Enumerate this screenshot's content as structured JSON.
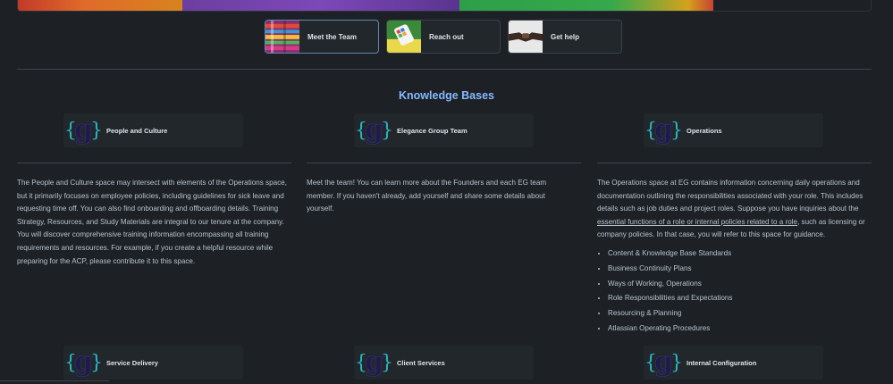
{
  "banner": {
    "colors": [
      "#c23a2a",
      "#d8831e",
      "#6b3fa0",
      "#7d48b8",
      "#2f9e49",
      "#35a94b",
      "#d4a21d",
      "#c94231",
      "#1d2125"
    ]
  },
  "quick_links": [
    {
      "label": "Meet the Team",
      "thumb": "colorful-blocks-image",
      "active": true
    },
    {
      "label": "Reach out",
      "thumb": "phone-apps-image",
      "active": false
    },
    {
      "label": "Get help",
      "thumb": "handshake-image",
      "active": false
    }
  ],
  "kb_title": "Knowledge Bases",
  "cards_row1": [
    "People and Culture",
    "Elegance Group Team",
    "Operations"
  ],
  "cards_row2": [
    "Service Delivery",
    "Client Services",
    "Internal Configuration"
  ],
  "col1": {
    "text": "The People and Culture space may intersect with elements of the Operations space, but it primarily focuses on employee policies, including guidelines for sick leave and requesting time off. You can also find onboarding and offboarding details. Training Strategy, Resources, and Study Materials are integral to our tenure at the company. You will discover comprehensive training information encompassing all training requirements and resources. For example, if you create a helpful resource while preparing for the ACP, please contribute it to this space."
  },
  "col2": {
    "text": "Meet the team! You can learn more about the Founders and each EG team member. If you haven't already, add yourself and share some details about yourself."
  },
  "col3": {
    "text_before": "The Operations space at EG contains information concerning daily operations and documentation outlining the responsibilities associated with your role. This includes details such as job duties and project roles. Suppose you have inquiries about the ",
    "link": "essential functions of a role or internal policies related to a role",
    "text_after": ", such as licensing or company policies. In that case, you will refer to this space for guidance.",
    "bullets": [
      "Content & Knowledge Base Standards",
      "Business Continuity Plans",
      "Ways of Working, Operations",
      "Role Responsibilities and Expectations",
      "Resourcing & Planning",
      "Atlassian Operating Procedures"
    ]
  },
  "logo": {
    "brace_color": "#2bb5c4",
    "letter_color": "#1e1a4a",
    "icon": "eg-logo-icon"
  }
}
